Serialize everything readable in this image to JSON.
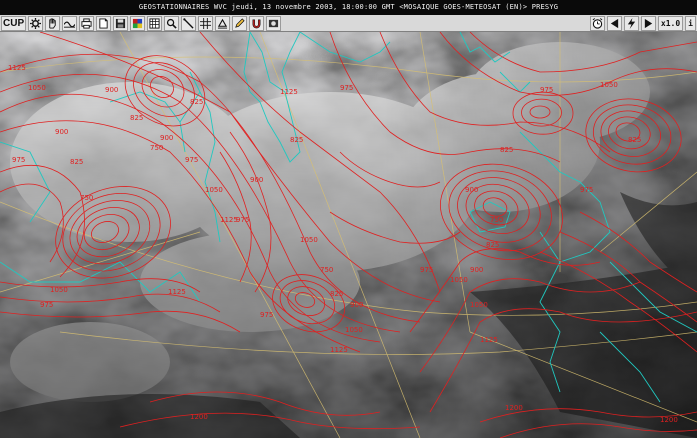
{
  "window": {
    "title": "GEOSTATIONNAIRES WVC jeudi, 13 novembre 2003, 18:00:00 GMT <MOSAIQUE GOES-METEOSAT (EN)> PRESYG"
  },
  "toolbar": {
    "left": [
      {
        "name": "cup-button",
        "label": "CUP",
        "icon": "text"
      },
      {
        "name": "gear-button",
        "label": "",
        "icon": "gear-icon"
      },
      {
        "name": "hand-button",
        "label": "",
        "icon": "hand-icon"
      },
      {
        "name": "wave-button",
        "label": "",
        "icon": "wave-icon"
      },
      {
        "name": "print-button",
        "label": "",
        "icon": "printer-icon"
      },
      {
        "name": "page-button",
        "label": "",
        "icon": "page-icon"
      },
      {
        "name": "save-button",
        "label": "",
        "icon": "floppy-icon"
      },
      {
        "name": "palette-button",
        "label": "",
        "icon": "palette-icon"
      },
      {
        "name": "layers-button",
        "label": "",
        "icon": "layers-icon"
      },
      {
        "name": "zoom-button",
        "label": "",
        "icon": "magnifier-icon"
      },
      {
        "name": "draw-line-button",
        "label": "",
        "icon": "line-icon"
      },
      {
        "name": "grid-button",
        "label": "",
        "icon": "grid-icon"
      },
      {
        "name": "rotate-button",
        "label": "",
        "icon": "rotate-icon"
      },
      {
        "name": "pencil-button",
        "label": "",
        "icon": "pencil-icon"
      },
      {
        "name": "magnet-button",
        "label": "",
        "icon": "magnet-icon"
      },
      {
        "name": "animate-button",
        "label": "",
        "icon": "film-icon"
      }
    ],
    "right": [
      {
        "name": "clock-button",
        "label": "",
        "icon": "clock-icon"
      },
      {
        "name": "prev-frame-button",
        "label": "",
        "icon": "triangle-left-icon"
      },
      {
        "name": "loop-button",
        "label": "",
        "icon": "lightning-icon"
      },
      {
        "name": "next-frame-button",
        "label": "",
        "icon": "triangle-right-icon"
      },
      {
        "name": "frame-step-button",
        "label": "x1.0",
        "icon": "text"
      },
      {
        "name": "info-button",
        "label": "i",
        "icon": "text"
      }
    ]
  },
  "map": {
    "contour_color": "#e02020",
    "coast_color": "#20c8c0",
    "grid_color": "#d8c070",
    "contour_labels": [
      "1125",
      "1050",
      "975",
      "900",
      "825",
      "750",
      "975",
      "1050",
      "1125",
      "900",
      "825",
      "750",
      "825",
      "900",
      "975",
      "1050",
      "1125",
      "975",
      "1125",
      "1050",
      "825",
      "900",
      "975",
      "1050",
      "750",
      "825",
      "900",
      "975",
      "1125",
      "1050",
      "825",
      "900",
      "975",
      "1050",
      "1125",
      "900",
      "750",
      "825",
      "975",
      "1050",
      "1200",
      "1200",
      "1200",
      "975",
      "825"
    ]
  }
}
